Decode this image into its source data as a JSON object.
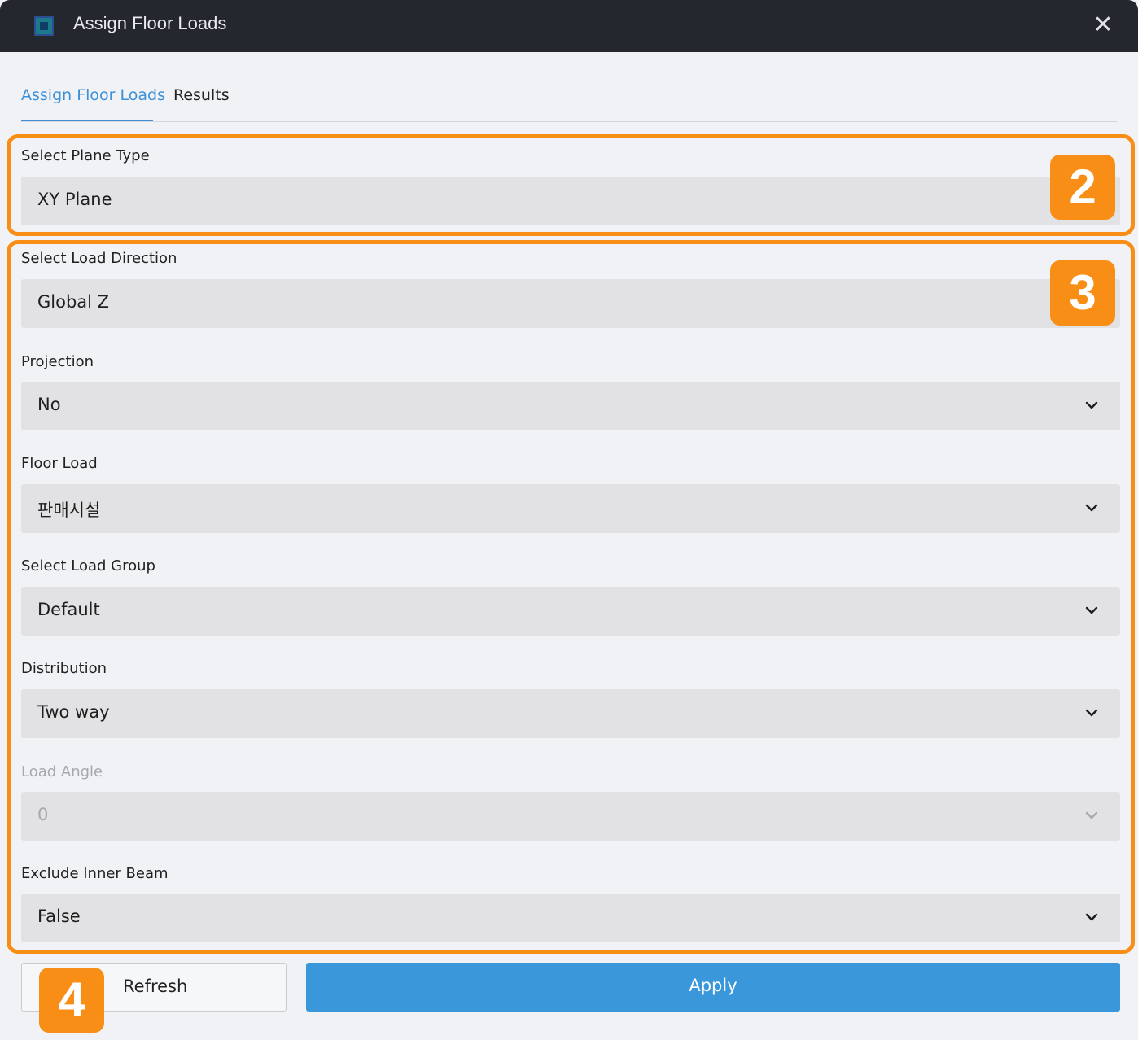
{
  "window": {
    "title": "Assign Floor Loads",
    "close_icon": "close-icon"
  },
  "tabs": [
    {
      "label": "Assign Floor Loads",
      "active": true
    },
    {
      "label": "Results",
      "active": false
    }
  ],
  "form": {
    "plane_type": {
      "label": "Select Plane Type",
      "value": "XY Plane",
      "dropdown": false
    },
    "load_direction": {
      "label": "Select Load Direction",
      "value": "Global Z",
      "dropdown": false
    },
    "projection": {
      "label": "Projection",
      "value": "No",
      "dropdown": true
    },
    "floor_load": {
      "label": "Floor Load",
      "value": "판매시설",
      "dropdown": true
    },
    "load_group": {
      "label": "Select Load Group",
      "value": "Default",
      "dropdown": true
    },
    "distribution": {
      "label": "Distribution",
      "value": "Two way",
      "dropdown": true
    },
    "load_angle": {
      "label": "Load Angle",
      "value": "0",
      "dropdown": true,
      "disabled": true
    },
    "exclude_inner_beam": {
      "label": "Exclude Inner Beam",
      "value": "False",
      "dropdown": true
    }
  },
  "buttons": {
    "refresh_label": "Refresh",
    "apply_label": "Apply"
  },
  "annotations": {
    "badge_2": "2",
    "badge_3": "3",
    "badge_4": "4",
    "highlight_color": "#f98e16"
  },
  "colors": {
    "accent": "#3d8fd6",
    "apply": "#3a98da",
    "titlebar": "#24272d"
  }
}
